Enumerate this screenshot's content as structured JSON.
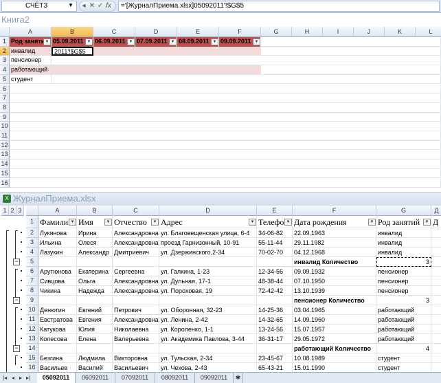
{
  "formula_bar": {
    "name_box": "СЧЁТЗ",
    "buttons": [
      "✕",
      "✓",
      "fx"
    ],
    "formula": "='[ЖурналПриема.xlsx]05092011'!$G$5"
  },
  "book1": {
    "title": "Книга2",
    "columns": [
      "A",
      "B",
      "C",
      "D",
      "E",
      "F",
      "G",
      "H",
      "I",
      "J",
      "K",
      "L"
    ],
    "rows": [
      "1",
      "2",
      "3",
      "4",
      "5",
      "6",
      "7",
      "8",
      "9",
      "10",
      "11",
      "12",
      "13",
      "14",
      "15",
      "16"
    ],
    "header": [
      "Род занятий",
      "05.09.2011",
      "06.09.2011",
      "07.09.2011",
      "08.09.2011",
      "09.09.2011"
    ],
    "labels": [
      "инвалид",
      "пенсионер",
      "работающий",
      "студент"
    ],
    "edit_text": "2011'!$G$5"
  },
  "book2": {
    "title": "ЖурналПриема.xlsx",
    "levels": [
      "1",
      "2",
      "3"
    ],
    "columns": [
      "A",
      "B",
      "C",
      "D",
      "E",
      "F",
      "G",
      "Д"
    ],
    "header": [
      "Фамилия",
      "Имя",
      "Отчество",
      "Адрес",
      "Телефон",
      "Дата рождения",
      "Род занятий",
      "Д"
    ],
    "rows": [
      {
        "n": "2",
        "cells": [
          "Лукянова",
          "Ирина",
          "Александровна",
          "ул. Благовещенская улица, 6-4",
          "34-06-82",
          "22.09.1963",
          "инвалид"
        ]
      },
      {
        "n": "3",
        "cells": [
          "Ильина",
          "Олеся",
          "Александровна",
          "проезд Гарнизонный, 10-91",
          "55-11-44",
          "29.11.1982",
          "инвалид"
        ]
      },
      {
        "n": "4",
        "cells": [
          "Лазукин",
          "Александр",
          "Дмитриевич",
          "ул. Дзержинского,2-34",
          "70-02-70",
          "04.12.1968",
          "инвалид"
        ]
      },
      {
        "n": "5",
        "subtotal": "инвалид Количество",
        "count": "3"
      },
      {
        "n": "6",
        "cells": [
          "Арутюнова",
          "Екатерина",
          "Сергеевна",
          "ул. Галкина, 1-23",
          "12-34-56",
          "09.09.1932",
          "пенсионер"
        ]
      },
      {
        "n": "7",
        "cells": [
          "Сивцова",
          "Ольга",
          "Александровна",
          "ул. Дульная, 17-1",
          "48-38-44",
          "07.10.1950",
          "пенсионер"
        ]
      },
      {
        "n": "8",
        "cells": [
          "Чикина",
          "Надежда",
          "Александровна",
          "ул. Пороховая, 19",
          "72-42-42",
          "13.10.1939",
          "пенсионер"
        ]
      },
      {
        "n": "9",
        "subtotal": "пенсионер Количество",
        "count": "3"
      },
      {
        "n": "10",
        "cells": [
          "Денютин",
          "Евгений",
          "Петрович",
          "ул. Оборонная, 32-23",
          "14-25-36",
          "03.04.1965",
          "работающий"
        ]
      },
      {
        "n": "11",
        "cells": [
          "Евстратова",
          "Евгения",
          "Александровна",
          "ул. Ленина, 2-42",
          "14-32-65",
          "14.09.1960",
          "работающий"
        ]
      },
      {
        "n": "12",
        "cells": [
          "Катукова",
          "Юлия",
          "Николаевна",
          "ул. Короленко, 1-1",
          "13-24-56",
          "15.07.1957",
          "работающий"
        ]
      },
      {
        "n": "13",
        "cells": [
          "Колесова",
          "Елена",
          "Валерьевна",
          "ул. Академика Павлова, 3-44",
          "36-31-17",
          "29.05.1972",
          "работающий"
        ]
      },
      {
        "n": "14",
        "subtotal": "работающий Количество",
        "count": "4"
      },
      {
        "n": "15",
        "cells": [
          "Безгина",
          "Людмила",
          "Викторовна",
          "ул. Тульская, 2-34",
          "23-45-67",
          "10.08.1989",
          "студент"
        ]
      },
      {
        "n": "16",
        "cells": [
          "Васильев",
          "Василий",
          "Васильевич",
          "ул. Чехова, 2-43",
          "65-43-21",
          "15.01.1990",
          "студент"
        ]
      }
    ]
  },
  "tabs": [
    "05092011",
    "06092011",
    "07092011",
    "08092011",
    "09092011"
  ],
  "colors": {
    "header_fill": "#c0504d",
    "row_band": "#f2dcdb",
    "selected_header": "#f5b94b"
  }
}
